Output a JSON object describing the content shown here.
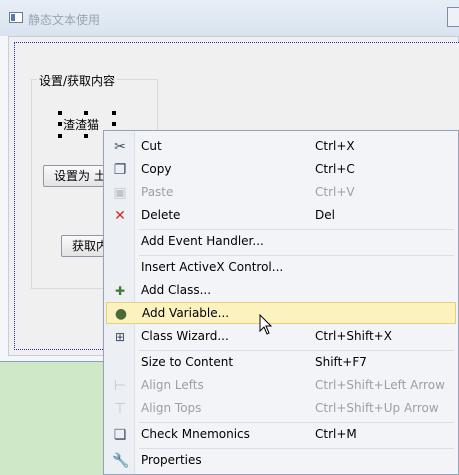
{
  "window": {
    "title": "静态文本使用"
  },
  "dialog": {
    "group_label": "设置/获取内容",
    "static_text": "渣渣猫",
    "set_button": "设置为 土",
    "get_button": "获取内"
  },
  "menu": {
    "items": [
      {
        "label": "Cut",
        "shortcut": "Ctrl+X",
        "icon": "scissors-icon",
        "enabled": true
      },
      {
        "label": "Copy",
        "shortcut": "Ctrl+C",
        "icon": "copy-icon",
        "enabled": true
      },
      {
        "label": "Paste",
        "shortcut": "Ctrl+V",
        "icon": "paste-icon",
        "enabled": false
      },
      {
        "label": "Delete",
        "shortcut": "Del",
        "icon": "delete-icon",
        "enabled": true
      },
      {
        "label": "Add Event Handler...",
        "shortcut": "",
        "icon": "",
        "enabled": true
      },
      {
        "label": "Insert ActiveX Control...",
        "shortcut": "",
        "icon": "",
        "enabled": true
      },
      {
        "label": "Add Class...",
        "shortcut": "",
        "icon": "add-class-icon",
        "enabled": true
      },
      {
        "label": "Add Variable...",
        "shortcut": "",
        "icon": "add-variable-icon",
        "enabled": true,
        "highlighted": true
      },
      {
        "label": "Class Wizard...",
        "shortcut": "Ctrl+Shift+X",
        "icon": "class-wizard-icon",
        "enabled": true
      },
      {
        "label": "Size to Content",
        "shortcut": "Shift+F7",
        "icon": "",
        "enabled": true
      },
      {
        "label": "Align Lefts",
        "shortcut": "Ctrl+Shift+Left Arrow",
        "icon": "align-left-icon",
        "enabled": false
      },
      {
        "label": "Align Tops",
        "shortcut": "Ctrl+Shift+Up Arrow",
        "icon": "align-top-icon",
        "enabled": false
      },
      {
        "label": "Check Mnemonics",
        "shortcut": "Ctrl+M",
        "icon": "check-mnemonics-icon",
        "enabled": true
      },
      {
        "label": "Properties",
        "shortcut": "",
        "icon": "properties-icon",
        "enabled": true
      }
    ]
  },
  "colors": {
    "highlight": "#fbf2c0",
    "background": "#cfe8c8",
    "delete_red": "#d42c1e"
  }
}
